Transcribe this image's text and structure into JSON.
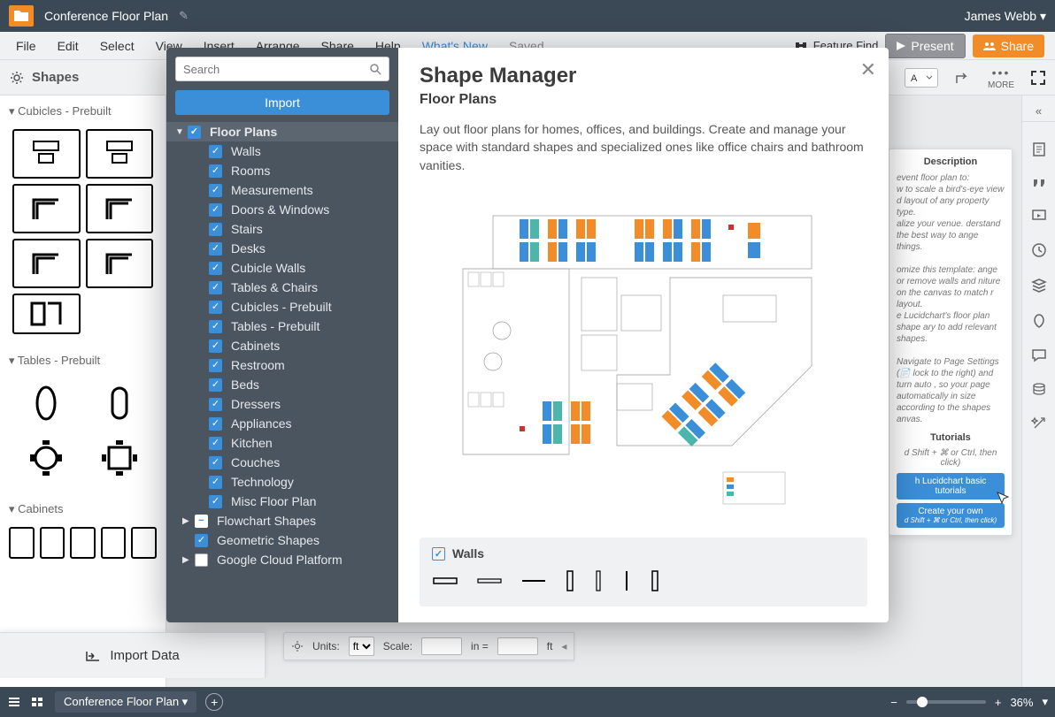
{
  "titlebar": {
    "title": "Conference Floor Plan",
    "user": "James Webb ▾"
  },
  "menu": {
    "items": [
      "File",
      "Edit",
      "Select",
      "View",
      "Insert",
      "Arrange",
      "Share",
      "Help"
    ],
    "whats_new": "What's New",
    "saved": "Saved",
    "feature_find": "Feature Find",
    "present": "Present",
    "share": "Share"
  },
  "toolbar": {
    "shapes": "Shapes",
    "more": "MORE"
  },
  "leftbar": {
    "sections": [
      {
        "title": "Cubicles - Prebuilt"
      },
      {
        "title": "Tables - Prebuilt"
      },
      {
        "title": "Cabinets"
      }
    ],
    "import_data": "Import Data"
  },
  "modal": {
    "search_placeholder": "Search",
    "import_button": "Import",
    "tree": {
      "floor_plans": "Floor Plans",
      "children": [
        "Walls",
        "Rooms",
        "Measurements",
        "Doors & Windows",
        "Stairs",
        "Desks",
        "Cubicle Walls",
        "Tables & Chairs",
        "Cubicles - Prebuilt",
        "Tables - Prebuilt",
        "Cabinets",
        "Restroom",
        "Beds",
        "Dressers",
        "Appliances",
        "Kitchen",
        "Couches",
        "Technology",
        "Misc Floor Plan"
      ],
      "flowchart": "Flowchart Shapes",
      "geometric": "Geometric Shapes",
      "gcp": "Google Cloud Platform"
    },
    "title": "Shape Manager",
    "subtitle": "Floor Plans",
    "description": "Lay out floor plans for homes, offices, and buildings. Create and manage your space with standard shapes and specialized ones like office chairs and bathroom vanities.",
    "walls_label": "Walls"
  },
  "desc_panel": {
    "heading": "Description",
    "body1": "event floor plan to:",
    "body2": "w to scale a bird's-eye view d layout of any property type.",
    "body3": "alize your venue. derstand the best way to ange things.",
    "body4": "omize this template: ange or remove walls and niture on the canvas to match r layout.",
    "body5": "e Lucidchart's floor plan shape ary to add relevant shapes.",
    "body6": "Navigate to Page Settings (📄 lock to the right) and turn auto , so your page automatically in size according to the shapes anvas.",
    "tutorials": "Tutorials",
    "tip": "d Shift + ⌘ or Ctrl, then click)",
    "btn1": "h Lucidchart basic tutorials",
    "btn2": "Create your own",
    "btn2sub": "d Shift + ⌘ or Ctrl, then click)"
  },
  "unitsbar": {
    "units_label": "Units:",
    "units": "ft",
    "scale_label": "Scale:",
    "in": "in =",
    "out": "ft"
  },
  "bottombar": {
    "page": "Conference Floor Plan ▾",
    "zoom": "36%"
  }
}
